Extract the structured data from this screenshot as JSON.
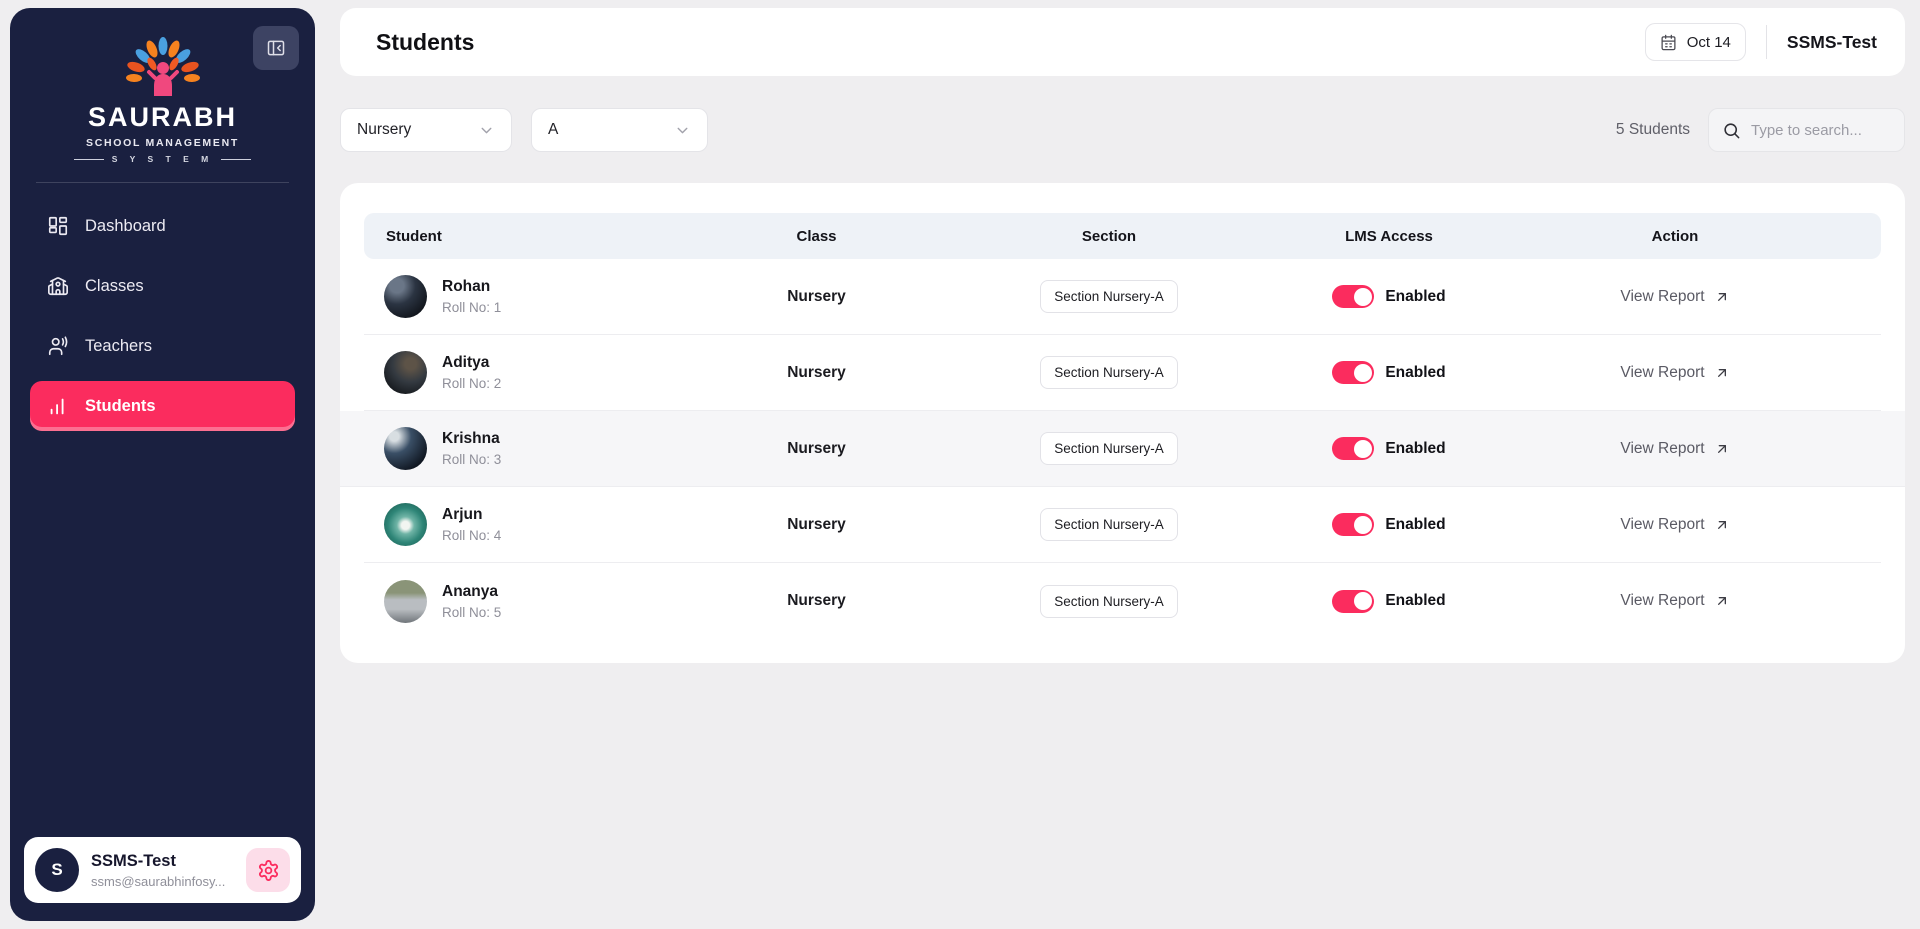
{
  "app": {
    "accent_color": "#fb2c5e",
    "sidebar_color": "#1a2040",
    "background_color": "#efeef0"
  },
  "sidebar": {
    "logo": {
      "title": "SAURABH",
      "subtitle": "SCHOOL MANAGEMENT",
      "tagline": "S Y S T E M"
    },
    "items": [
      {
        "label": "Dashboard",
        "icon": "dashboard-icon",
        "active": false
      },
      {
        "label": "Classes",
        "icon": "school-icon",
        "active": false
      },
      {
        "label": "Teachers",
        "icon": "teachers-icon",
        "active": false
      },
      {
        "label": "Students",
        "icon": "chart-bars-icon",
        "active": true
      }
    ],
    "user": {
      "initial": "S",
      "name": "SSMS-Test",
      "email": "ssms@saurabhinfosy..."
    }
  },
  "header": {
    "title": "Students",
    "date_label": "Oct 14",
    "account_name": "SSMS-Test"
  },
  "filters": {
    "class_value": "Nursery",
    "section_value": "A",
    "count_label": "5 Students",
    "search_placeholder": "Type to search..."
  },
  "table": {
    "columns": [
      "Student",
      "Class",
      "Section",
      "LMS Access",
      "Action"
    ],
    "rows": [
      {
        "name": "Rohan",
        "roll": "Roll No: 1",
        "class": "Nursery",
        "section": "Section Nursery-A",
        "lms": "Enabled",
        "action": "View Report"
      },
      {
        "name": "Aditya",
        "roll": "Roll No: 2",
        "class": "Nursery",
        "section": "Section Nursery-A",
        "lms": "Enabled",
        "action": "View Report"
      },
      {
        "name": "Krishna",
        "roll": "Roll No: 3",
        "class": "Nursery",
        "section": "Section Nursery-A",
        "lms": "Enabled",
        "action": "View Report"
      },
      {
        "name": "Arjun",
        "roll": "Roll No: 4",
        "class": "Nursery",
        "section": "Section Nursery-A",
        "lms": "Enabled",
        "action": "View Report"
      },
      {
        "name": "Ananya",
        "roll": "Roll No: 5",
        "class": "Nursery",
        "section": "Section Nursery-A",
        "lms": "Enabled",
        "action": "View Report"
      }
    ]
  },
  "icons": {
    "collapse": "panel-collapse-icon",
    "calendar": "calendar-icon",
    "search": "search-icon",
    "gear": "gear-icon",
    "arrow": "arrow-up-right-icon",
    "chevron": "chevron-down-icon"
  }
}
